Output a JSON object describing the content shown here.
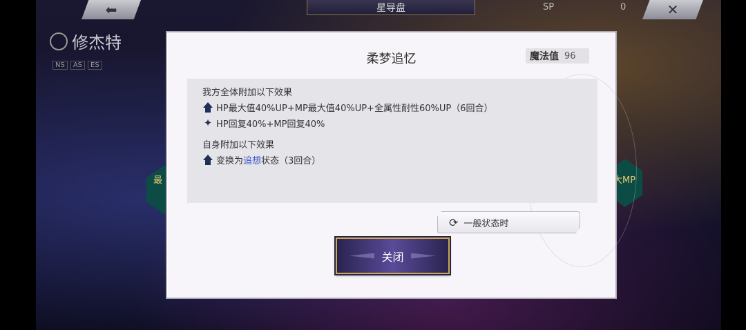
{
  "background": {
    "back_glyph": "⬅",
    "screen_title": "星导盘",
    "sp_label": "SP",
    "sp_value": "0",
    "close_glyph": "✕",
    "character_name": "修杰特",
    "character_tags": [
      "NS",
      "AS",
      "ES"
    ],
    "side_left": "最",
    "side_right": "大MP"
  },
  "dialog": {
    "title": "柔梦追忆",
    "mp": {
      "label": "魔法值",
      "value": "96"
    },
    "sections": [
      {
        "heading": "我方全体附加以下效果",
        "effects": [
          {
            "icon": "up-arrow-icon",
            "text": "HP最大值40%UP+MP最大值40%UP+全属性耐性60%UP（6回合）"
          },
          {
            "icon": "sparkle-icon",
            "text": "HP回复40%+MP回复40%"
          }
        ]
      },
      {
        "heading": "自身附加以下效果",
        "effects": [
          {
            "icon": "up-arrow-icon",
            "prefix": "变换为",
            "link": "追想",
            "suffix": "状态（3回合）"
          }
        ]
      }
    ],
    "state_button": {
      "icon": "refresh-icon",
      "label": "一般状态时"
    },
    "close_button": {
      "label": "关闭"
    }
  }
}
